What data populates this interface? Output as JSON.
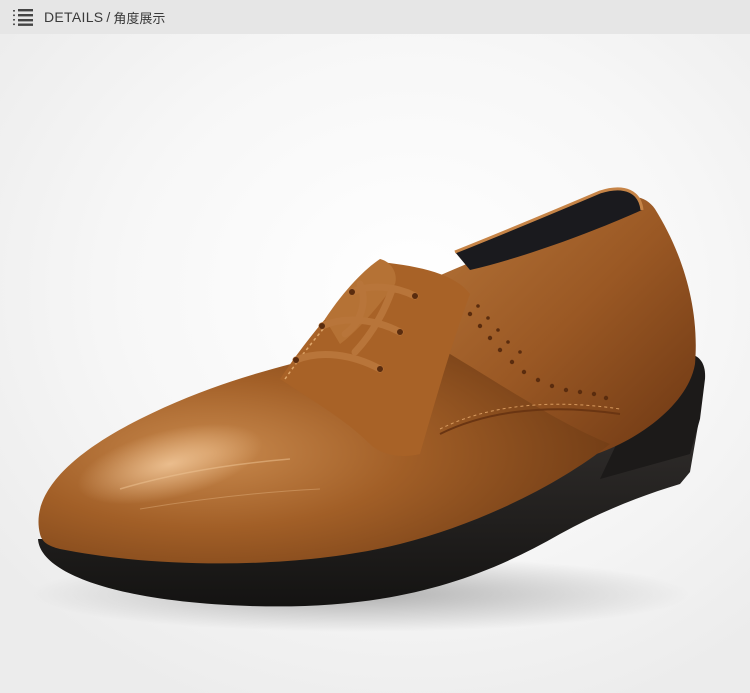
{
  "header": {
    "icon": "list-menu-icon",
    "title_en": "DETAILS",
    "separator": "/",
    "title_zh": "角度展示"
  },
  "product": {
    "image": "brown-leather-oxford-shoe",
    "colors": {
      "leather": "#8a4a1c",
      "leather_light": "#c27a3c",
      "sole": "#1f1d1c",
      "lace": "#b06a30",
      "header_bg": "#e6e6e6"
    }
  }
}
